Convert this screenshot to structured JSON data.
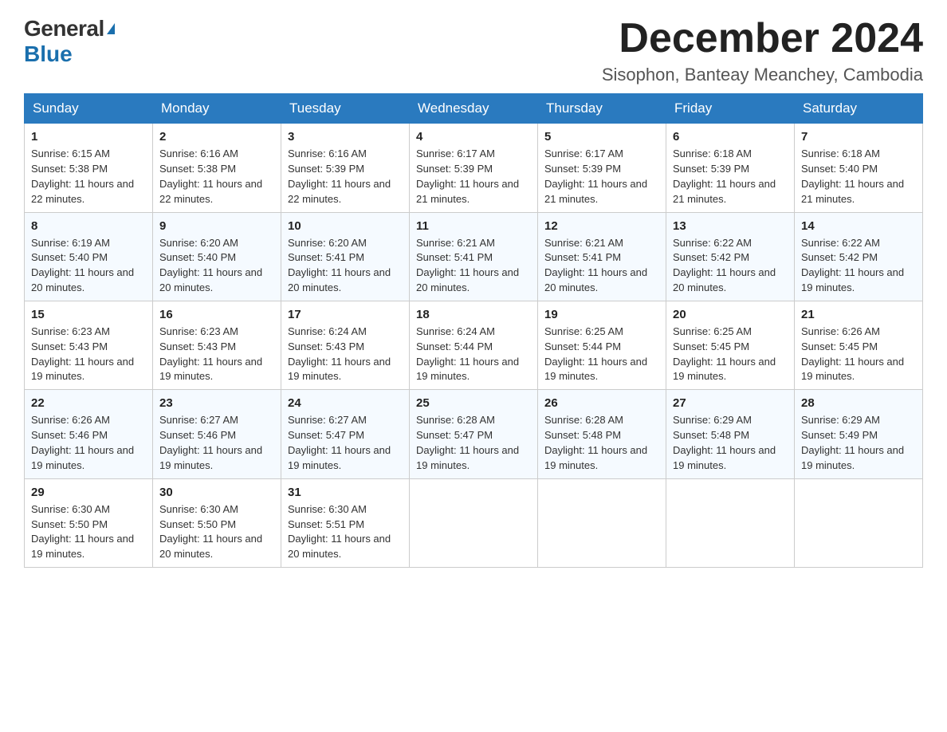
{
  "logo": {
    "general": "General",
    "blue": "Blue",
    "triangle": "▶"
  },
  "title": "December 2024",
  "location": "Sisophon, Banteay Meanchey, Cambodia",
  "weekdays": [
    "Sunday",
    "Monday",
    "Tuesday",
    "Wednesday",
    "Thursday",
    "Friday",
    "Saturday"
  ],
  "weeks": [
    [
      {
        "day": "1",
        "sunrise": "6:15 AM",
        "sunset": "5:38 PM",
        "daylight": "11 hours and 22 minutes."
      },
      {
        "day": "2",
        "sunrise": "6:16 AM",
        "sunset": "5:38 PM",
        "daylight": "11 hours and 22 minutes."
      },
      {
        "day": "3",
        "sunrise": "6:16 AM",
        "sunset": "5:39 PM",
        "daylight": "11 hours and 22 minutes."
      },
      {
        "day": "4",
        "sunrise": "6:17 AM",
        "sunset": "5:39 PM",
        "daylight": "11 hours and 21 minutes."
      },
      {
        "day": "5",
        "sunrise": "6:17 AM",
        "sunset": "5:39 PM",
        "daylight": "11 hours and 21 minutes."
      },
      {
        "day": "6",
        "sunrise": "6:18 AM",
        "sunset": "5:39 PM",
        "daylight": "11 hours and 21 minutes."
      },
      {
        "day": "7",
        "sunrise": "6:18 AM",
        "sunset": "5:40 PM",
        "daylight": "11 hours and 21 minutes."
      }
    ],
    [
      {
        "day": "8",
        "sunrise": "6:19 AM",
        "sunset": "5:40 PM",
        "daylight": "11 hours and 20 minutes."
      },
      {
        "day": "9",
        "sunrise": "6:20 AM",
        "sunset": "5:40 PM",
        "daylight": "11 hours and 20 minutes."
      },
      {
        "day": "10",
        "sunrise": "6:20 AM",
        "sunset": "5:41 PM",
        "daylight": "11 hours and 20 minutes."
      },
      {
        "day": "11",
        "sunrise": "6:21 AM",
        "sunset": "5:41 PM",
        "daylight": "11 hours and 20 minutes."
      },
      {
        "day": "12",
        "sunrise": "6:21 AM",
        "sunset": "5:41 PM",
        "daylight": "11 hours and 20 minutes."
      },
      {
        "day": "13",
        "sunrise": "6:22 AM",
        "sunset": "5:42 PM",
        "daylight": "11 hours and 20 minutes."
      },
      {
        "day": "14",
        "sunrise": "6:22 AM",
        "sunset": "5:42 PM",
        "daylight": "11 hours and 19 minutes."
      }
    ],
    [
      {
        "day": "15",
        "sunrise": "6:23 AM",
        "sunset": "5:43 PM",
        "daylight": "11 hours and 19 minutes."
      },
      {
        "day": "16",
        "sunrise": "6:23 AM",
        "sunset": "5:43 PM",
        "daylight": "11 hours and 19 minutes."
      },
      {
        "day": "17",
        "sunrise": "6:24 AM",
        "sunset": "5:43 PM",
        "daylight": "11 hours and 19 minutes."
      },
      {
        "day": "18",
        "sunrise": "6:24 AM",
        "sunset": "5:44 PM",
        "daylight": "11 hours and 19 minutes."
      },
      {
        "day": "19",
        "sunrise": "6:25 AM",
        "sunset": "5:44 PM",
        "daylight": "11 hours and 19 minutes."
      },
      {
        "day": "20",
        "sunrise": "6:25 AM",
        "sunset": "5:45 PM",
        "daylight": "11 hours and 19 minutes."
      },
      {
        "day": "21",
        "sunrise": "6:26 AM",
        "sunset": "5:45 PM",
        "daylight": "11 hours and 19 minutes."
      }
    ],
    [
      {
        "day": "22",
        "sunrise": "6:26 AM",
        "sunset": "5:46 PM",
        "daylight": "11 hours and 19 minutes."
      },
      {
        "day": "23",
        "sunrise": "6:27 AM",
        "sunset": "5:46 PM",
        "daylight": "11 hours and 19 minutes."
      },
      {
        "day": "24",
        "sunrise": "6:27 AM",
        "sunset": "5:47 PM",
        "daylight": "11 hours and 19 minutes."
      },
      {
        "day": "25",
        "sunrise": "6:28 AM",
        "sunset": "5:47 PM",
        "daylight": "11 hours and 19 minutes."
      },
      {
        "day": "26",
        "sunrise": "6:28 AM",
        "sunset": "5:48 PM",
        "daylight": "11 hours and 19 minutes."
      },
      {
        "day": "27",
        "sunrise": "6:29 AM",
        "sunset": "5:48 PM",
        "daylight": "11 hours and 19 minutes."
      },
      {
        "day": "28",
        "sunrise": "6:29 AM",
        "sunset": "5:49 PM",
        "daylight": "11 hours and 19 minutes."
      }
    ],
    [
      {
        "day": "29",
        "sunrise": "6:30 AM",
        "sunset": "5:50 PM",
        "daylight": "11 hours and 19 minutes."
      },
      {
        "day": "30",
        "sunrise": "6:30 AM",
        "sunset": "5:50 PM",
        "daylight": "11 hours and 20 minutes."
      },
      {
        "day": "31",
        "sunrise": "6:30 AM",
        "sunset": "5:51 PM",
        "daylight": "11 hours and 20 minutes."
      },
      null,
      null,
      null,
      null
    ]
  ]
}
